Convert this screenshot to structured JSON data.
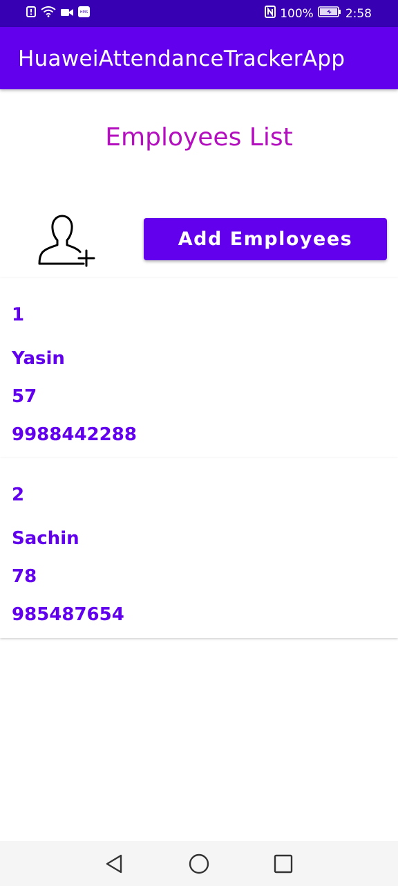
{
  "status_bar": {
    "battery": "100%",
    "time": "2:58",
    "icons": [
      "alert-icon",
      "wifi-icon",
      "video-icon",
      "hms-icon",
      "nfc-icon",
      "battery-icon"
    ]
  },
  "app_bar": {
    "title": "HuaweiAttendanceTrackerApp"
  },
  "page": {
    "title": "Employees List",
    "add_button_label": "Add Employees",
    "add_icon": "add-user-icon"
  },
  "employees": [
    {
      "id": "1",
      "name": "Yasin",
      "age": "57",
      "phone": "9988442288"
    },
    {
      "id": "2",
      "name": "Sachin",
      "age": "78",
      "phone": "985487654"
    }
  ],
  "nav_bar": {
    "icons": [
      "back-icon",
      "home-icon",
      "recent-apps-icon"
    ]
  },
  "colors": {
    "status_bar": "#3700b3",
    "app_bar": "#6200ee",
    "page_title": "#b40fbf",
    "employee_text": "#6200ee"
  }
}
